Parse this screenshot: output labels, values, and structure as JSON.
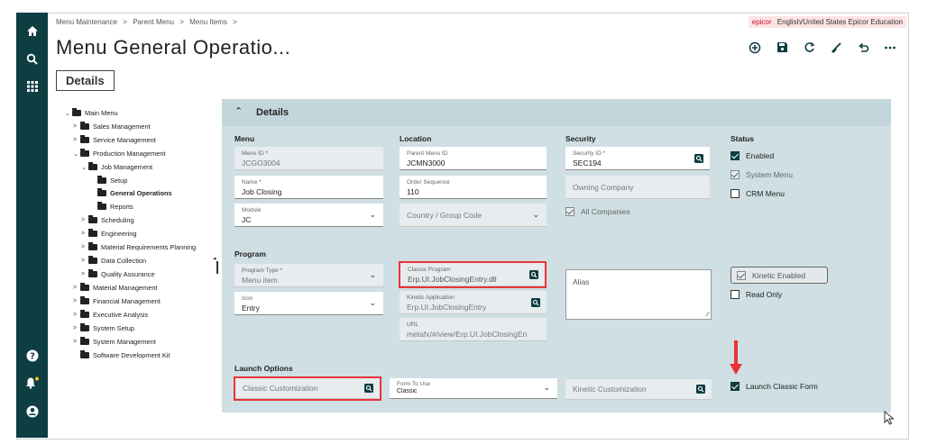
{
  "breadcrumb": [
    "Menu Maintenance",
    ">",
    "Parent Menu",
    ">",
    "Menu Items",
    ">"
  ],
  "header": {
    "brand": "epicor",
    "locale": "English/United States",
    "company": "Epicor Education"
  },
  "page_title": "Menu General Operatio...",
  "tab_label": "Details",
  "rail_icons": [
    "home-icon",
    "search-icon",
    "apps-grid-icon",
    "help-icon",
    "notifications-icon",
    "user-icon"
  ],
  "toolbar_icons": [
    "add-icon",
    "save-icon",
    "refresh-icon",
    "clear-icon",
    "undo-icon",
    "more-icon"
  ],
  "tree": {
    "root": "Main Menu",
    "items": [
      "Sales Management",
      "Service Management",
      "Production Management",
      "Job Management",
      "Setup",
      "General Operations",
      "Reports",
      "Scheduling",
      "Engineering",
      "Material Requirements Planning",
      "Data Collection",
      "Quality Assurance",
      "Material Management",
      "Financial Management",
      "Executive Analysis",
      "System Setup",
      "System Management",
      "Software Development Kit"
    ]
  },
  "panel": {
    "title": "Details"
  },
  "sections": {
    "menu": "Menu",
    "location": "Location",
    "security": "Security",
    "status": "Status",
    "program": "Program",
    "launch": "Launch Options"
  },
  "fields": {
    "menu_id": {
      "label": "Menu ID *",
      "value": "JCGO3004"
    },
    "name": {
      "label": "Name *",
      "value": "Job Closing"
    },
    "module": {
      "label": "Module",
      "value": "JC"
    },
    "parent_menu_id": {
      "label": "Parent Menu ID",
      "value": "JCMN3000"
    },
    "order_sequence": {
      "label": "Order Sequence",
      "value": "110"
    },
    "country_group_code": {
      "placeholder": "Country / Group Code"
    },
    "security_id": {
      "label": "Security ID *",
      "value": "SEC194"
    },
    "owning_company": {
      "placeholder": "Owning Company"
    },
    "program_type": {
      "label": "Program Type *",
      "value": "Menu item"
    },
    "icon": {
      "label": "Icon",
      "value": "Entry"
    },
    "classic_program": {
      "label": "Classic Program",
      "value": "Erp.UI.JobClosingEntry.dll"
    },
    "kinetic_application": {
      "label": "Kinetic Application",
      "value": "Erp.UI.JobClosingEntry"
    },
    "url": {
      "label": "URL",
      "value": "metafx/#/view/Erp.UI.JobClosingEn"
    },
    "alias": {
      "placeholder": "Alias"
    },
    "classic_customization": {
      "placeholder": "Classic Customization"
    },
    "form_to_use": {
      "label": "Form To Use",
      "value": "Classic"
    },
    "kinetic_customization": {
      "placeholder": "Kinetic Customization"
    }
  },
  "checkboxes": {
    "all_companies": {
      "label": "All Companies",
      "checked": true
    },
    "enabled": {
      "label": "Enabled",
      "checked": true
    },
    "system_menu": {
      "label": "System Menu",
      "checked": true
    },
    "crm_menu": {
      "label": "CRM Menu",
      "checked": false
    },
    "kinetic_enabled": {
      "label": "Kinetic Enabled",
      "checked": true
    },
    "read_only": {
      "label": "Read Only",
      "checked": false
    },
    "launch_classic_form": {
      "label": "Launch Classic Form",
      "checked": true
    }
  },
  "colors": {
    "rail": "#0e3d42",
    "panel": "#cfdfe3",
    "highlight": "#e8343a",
    "brand": "#c8102e"
  }
}
